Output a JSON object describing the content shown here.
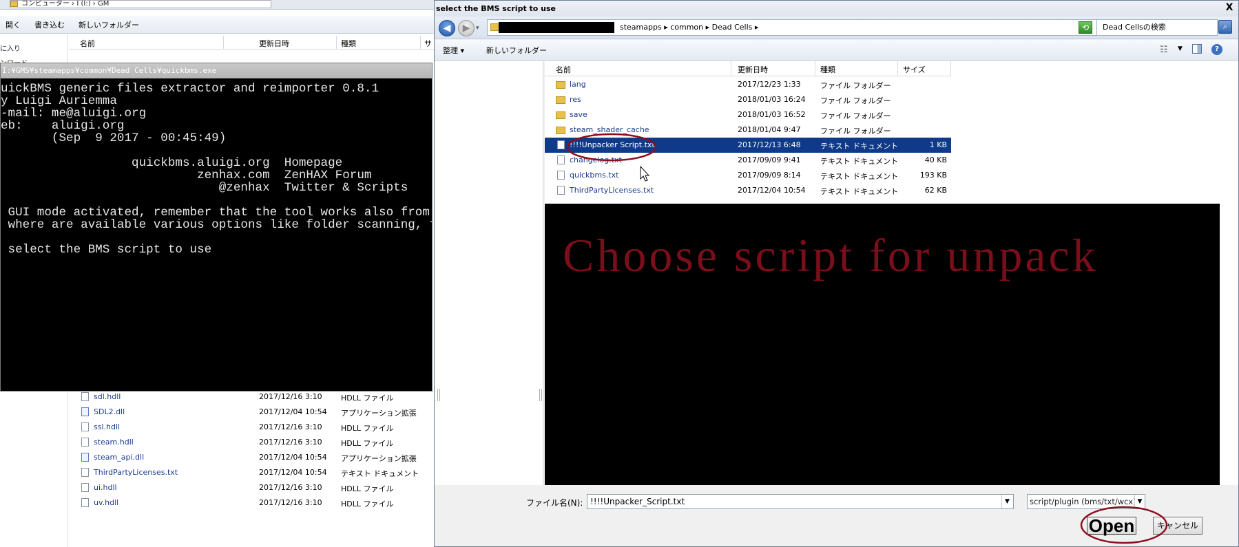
{
  "background_explorer": {
    "address": "コンピューター › I (I:) › GM",
    "toolbar": [
      "開く",
      "書き込む",
      "新しいフォルダー"
    ],
    "nav_items": [
      "に入り",
      "ンロード"
    ],
    "columns": [
      "名前",
      "更新日時",
      "種類",
      "サ"
    ],
    "files": [
      {
        "name": "sdl.hdll",
        "date": "2017/12/16 3:10",
        "type": "HDLL ファイル",
        "icon": "file-icon"
      },
      {
        "name": "SDL2.dll",
        "date": "2017/12/04 10:54",
        "type": "アプリケーション拡張",
        "icon": "dll-icon"
      },
      {
        "name": "ssl.hdll",
        "date": "2017/12/16 3:10",
        "type": "HDLL ファイル",
        "icon": "file-icon"
      },
      {
        "name": "steam.hdll",
        "date": "2017/12/16 3:10",
        "type": "HDLL ファイル",
        "icon": "file-icon"
      },
      {
        "name": "steam_api.dll",
        "date": "2017/12/04 10:54",
        "type": "アプリケーション拡張",
        "icon": "dll-icon"
      },
      {
        "name": "ThirdPartyLicenses.txt",
        "date": "2017/12/04 10:54",
        "type": "テキスト ドキュメント",
        "icon": "file-icon"
      },
      {
        "name": "ui.hdll",
        "date": "2017/12/16 3:10",
        "type": "HDLL ファイル",
        "icon": "file-icon"
      },
      {
        "name": "uv.hdll",
        "date": "2017/12/16 3:10",
        "type": "HDLL ファイル",
        "icon": "file-icon"
      }
    ]
  },
  "console": {
    "title": "I:¥GMS¥steamapps¥common¥Dead Cells¥quickbms.exe",
    "lines": [
      "uickBMS generic files extractor and reimporter 0.8.1",
      "y Luigi Auriemma",
      "-mail: me@aluigi.org",
      "eb:    aluigi.org",
      "       (Sep  9 2017 - 00:45:49)",
      "",
      "                  quickbms.aluigi.org  Homepage",
      "                           zenhax.com  ZenHAX Forum",
      "                              @zenhax  Twitter & Scripts",
      "",
      " GUI mode activated, remember that the tool works also from com",
      " where are available various options like folder scanning, filt",
      "",
      " select the BMS script to use"
    ]
  },
  "dialog": {
    "title": "select the BMS script to use",
    "close_glyph": "X",
    "address_path": "steamapps ▸ common ▸ Dead Cells ▸",
    "search_placeholder": "Dead Cellsの検索",
    "organize_label": "整理 ▾",
    "new_folder_label": "新しいフォルダー",
    "columns": [
      "名前",
      "更新日時",
      "種類",
      "サイズ"
    ],
    "files": [
      {
        "name": "lang",
        "date": "2017/12/23 1:33",
        "type": "ファイル フォルダー",
        "size": "",
        "kind": "folder",
        "selected": false
      },
      {
        "name": "res",
        "date": "2018/01/03 16:24",
        "type": "ファイル フォルダー",
        "size": "",
        "kind": "folder",
        "selected": false
      },
      {
        "name": "save",
        "date": "2018/01/03 16:52",
        "type": "ファイル フォルダー",
        "size": "",
        "kind": "folder",
        "selected": false
      },
      {
        "name": "steam_shader_cache",
        "date": "2018/01/04 9:47",
        "type": "ファイル フォルダー",
        "size": "",
        "kind": "folder",
        "selected": false
      },
      {
        "name": "!!!!Unpacker Script.txt",
        "date": "2017/12/13 6:48",
        "type": "テキスト ドキュメント",
        "size": "1 KB",
        "kind": "file",
        "selected": true
      },
      {
        "name": "changelog.txt",
        "date": "2017/09/09 9:41",
        "type": "テキスト ドキュメント",
        "size": "40 KB",
        "kind": "file",
        "selected": false
      },
      {
        "name": "quickbms.txt",
        "date": "2017/09/09 8:14",
        "type": "テキスト ドキュメント",
        "size": "193 KB",
        "kind": "file",
        "selected": false
      },
      {
        "name": "ThirdPartyLicenses.txt",
        "date": "2017/12/04 10:54",
        "type": "テキスト ドキュメント",
        "size": "62 KB",
        "kind": "file",
        "selected": false
      }
    ],
    "overlay_text": "Choose script for unpack",
    "filename_label": "ファイル名(N):",
    "filename_value": "!!!!Unpacker_Script.txt",
    "filter_value": "script/plugin (bms/txt/wcx)",
    "open_label": "Open",
    "cancel_label": "キャンセル"
  },
  "annotation_color": "#8b0f1f"
}
